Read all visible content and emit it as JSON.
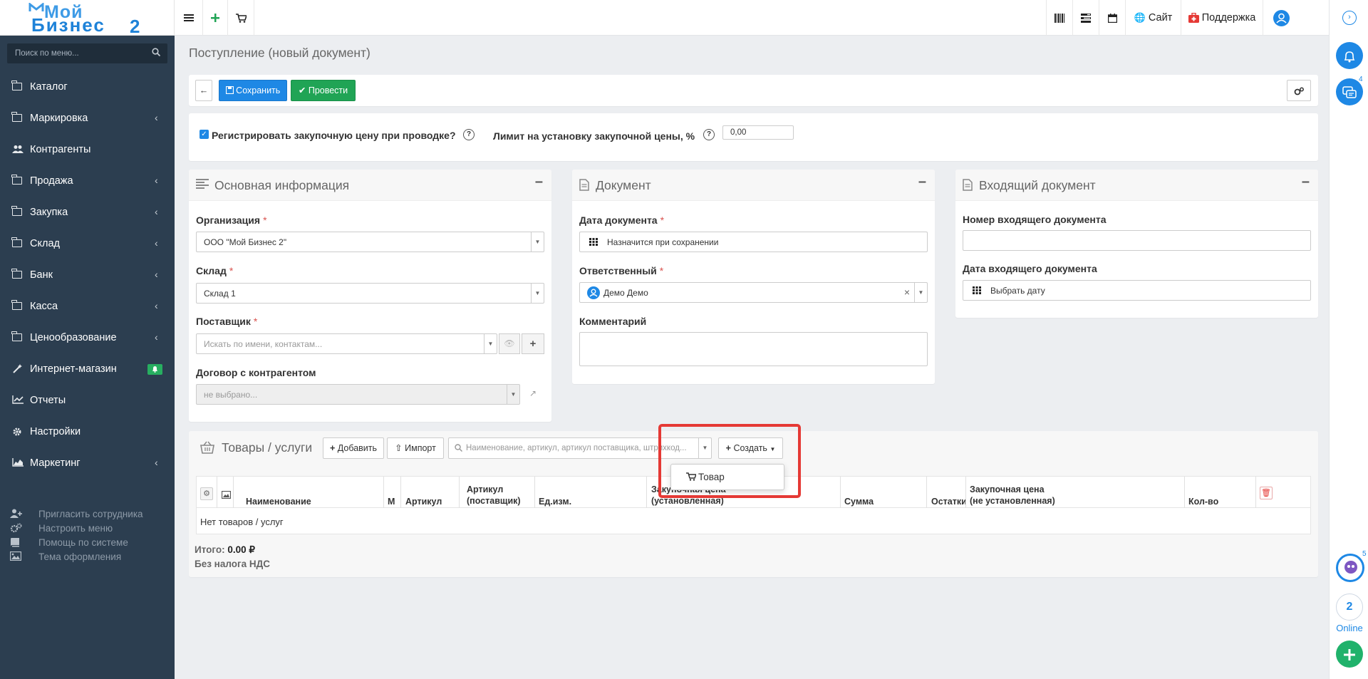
{
  "logo": {
    "line1": "Мой",
    "line2": "Бизнес",
    "line3": "2"
  },
  "sidebar": {
    "search_placeholder": "Поиск по меню...",
    "items": [
      {
        "label": "Каталог",
        "icon": "folder-icon",
        "has_children": false
      },
      {
        "label": "Маркировка",
        "icon": "folder-icon",
        "has_children": true
      },
      {
        "label": "Контрагенты",
        "icon": "users-icon",
        "has_children": false
      },
      {
        "label": "Продажа",
        "icon": "folder-icon",
        "has_children": true
      },
      {
        "label": "Закупка",
        "icon": "folder-icon",
        "has_children": true
      },
      {
        "label": "Склад",
        "icon": "folder-icon",
        "has_children": true
      },
      {
        "label": "Банк",
        "icon": "folder-icon",
        "has_children": true
      },
      {
        "label": "Касса",
        "icon": "folder-icon",
        "has_children": true
      },
      {
        "label": "Ценообразование",
        "icon": "folder-icon",
        "has_children": true
      },
      {
        "label": "Интернет-магазин",
        "icon": "magic-wand-icon",
        "has_children": false
      },
      {
        "label": "Отчеты",
        "icon": "line-chart-icon",
        "has_children": false
      },
      {
        "label": "Настройки",
        "icon": "gear-icon",
        "has_children": false
      },
      {
        "label": "Маркетинг",
        "icon": "area-chart-icon",
        "has_children": true
      }
    ],
    "footer": [
      {
        "label": "Пригласить сотрудника",
        "icon": "user-plus-icon"
      },
      {
        "label": "Настроить меню",
        "icon": "gears-icon"
      },
      {
        "label": "Помощь по системе",
        "icon": "book-icon"
      },
      {
        "label": "Тема оформления",
        "icon": "image-icon"
      }
    ]
  },
  "topbar": {
    "site_label": "Сайт",
    "support_label": "Поддержка"
  },
  "rail": {
    "chat_badge": "4",
    "assistant_badge": "5",
    "online_count": "2",
    "online_label": "Online"
  },
  "page": {
    "title": "Поступление (новый документ)"
  },
  "toolbar": {
    "save_label": "Сохранить",
    "post_label": "Провести"
  },
  "options": {
    "register_price_label": "Регистрировать закупочную цену при проводке?",
    "register_price_checked": true,
    "limit_label": "Лимит на установку закупочной цены, %",
    "limit_value": "0,00"
  },
  "main_info": {
    "title": "Основная информация",
    "org_label": "Организация",
    "org_value": "ООО \"Мой Бизнес 2\"",
    "warehouse_label": "Склад",
    "warehouse_value": "Склад 1",
    "supplier_label": "Поставщик",
    "supplier_placeholder": "Искать по имени, контактам...",
    "contract_label": "Договор с контрагентом",
    "contract_placeholder": "не выбрано..."
  },
  "document": {
    "title": "Документ",
    "date_label": "Дата документа",
    "date_value": "Назначится при сохранении",
    "responsible_label": "Ответственный",
    "responsible_value": "Демо Демо",
    "comment_label": "Комментарий"
  },
  "incoming": {
    "title": "Входящий документ",
    "number_label": "Номер входящего документа",
    "date_label": "Дата входящего документа",
    "date_placeholder": "Выбрать дату"
  },
  "goods": {
    "title": "Товары / услуги",
    "add_label": "Добавить",
    "import_label": "Импорт",
    "search_placeholder": "Наименование, артикул, артикул поставщика, штрихкод...",
    "create_label": "Создать",
    "create_menu": [
      "Товар"
    ],
    "columns": {
      "name": "Наименование",
      "m": "М",
      "article": "Артикул",
      "article_supplier_1": "Артикул",
      "article_supplier_2": "(поставщик)",
      "unit": "Ед.изм.",
      "price_1": "Закупочная цена",
      "price_2": "(установленная)",
      "sum": "Сумма",
      "stock": "Остатки",
      "price_unset_1": "Закупочная цена",
      "price_unset_2": "(не установленная)",
      "qty": "Кол-во"
    },
    "empty_text": "Нет товаров / услуг",
    "total_label": "Итого:",
    "total_value": "0.00 ₽",
    "vat_label": "Без налога НДС"
  },
  "colors": {
    "sidebar_bg": "#2c3e50",
    "primary": "#1e88e5",
    "success": "#20a455",
    "highlight": "#e53935"
  }
}
